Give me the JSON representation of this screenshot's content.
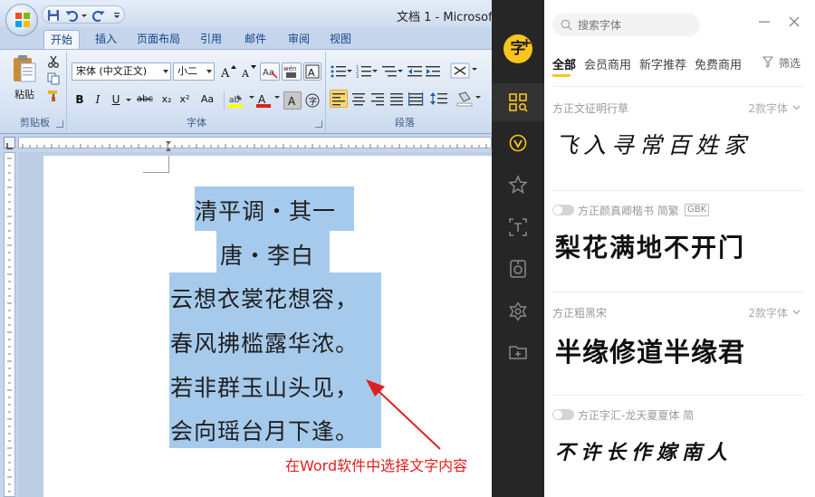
{
  "word": {
    "title": "文档 1 - Microsoft",
    "tabs": [
      "开始",
      "插入",
      "页面布局",
      "引用",
      "邮件",
      "审阅",
      "视图"
    ],
    "ribbon": {
      "clipboard": {
        "paste_label": "粘贴",
        "group_label": "剪贴板"
      },
      "font": {
        "font_name": "宋体 (中文正文)",
        "font_size": "小二",
        "group_label": "字体"
      },
      "paragraph": {
        "group_label": "段落"
      }
    },
    "document": {
      "lines": [
        "清平调・其一",
        "唐・李白",
        "云想衣裳花想容，",
        "春风拂槛露华浓。",
        "若非群玉山头见，",
        "会向瑶台月下逢。"
      ],
      "selection_color": "#a6caec"
    },
    "annotation": {
      "text": "在Word软件中选择文字内容",
      "color": "#e02020"
    }
  },
  "panel": {
    "logo_char": "字",
    "accent": "#f9c51c",
    "search_placeholder": "搜索字体",
    "categories": [
      "全部",
      "会员商用",
      "新字推荐",
      "免费商用"
    ],
    "filter_label": "筛选",
    "fonts": [
      {
        "name": "方正文征明行草",
        "count": "2款字体",
        "sample": "飞入寻常百姓家",
        "has_toggle": false,
        "badge": ""
      },
      {
        "name": "方正颜真卿楷书 简繁",
        "count": "",
        "sample": "梨花满地不开门",
        "has_toggle": true,
        "badge": "GBK"
      },
      {
        "name": "方正粗黑宋",
        "count": "2款字体",
        "sample": "半缘修道半缘君",
        "has_toggle": false,
        "badge": ""
      },
      {
        "name": "方正字汇-龙天夏夏体 简",
        "count": "",
        "sample": "不许长作嫁南人",
        "has_toggle": true,
        "badge": ""
      }
    ]
  }
}
